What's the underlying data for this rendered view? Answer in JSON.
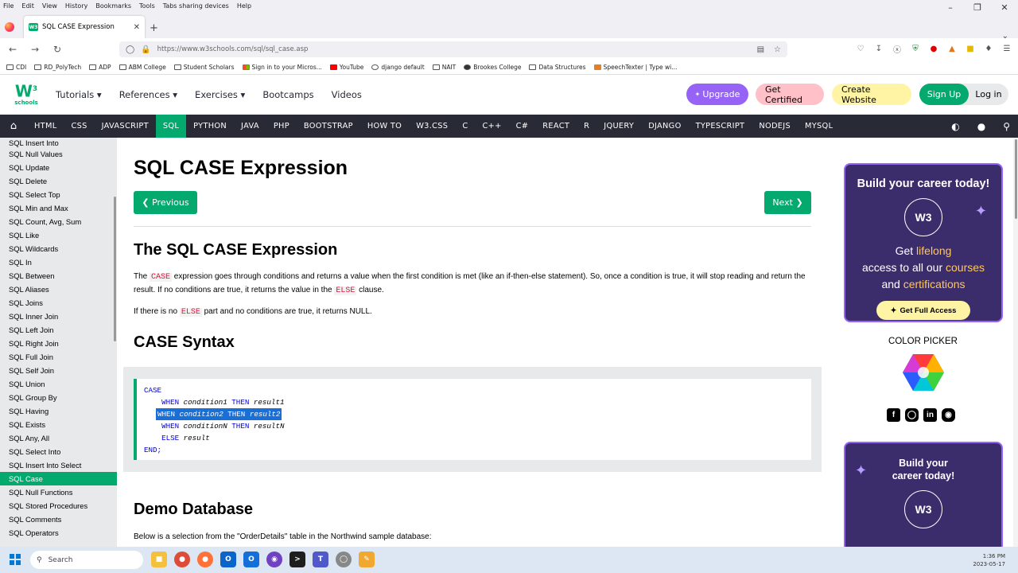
{
  "browser": {
    "menu": [
      "File",
      "Edit",
      "View",
      "History",
      "Bookmarks",
      "Tools",
      "Tabs sharing devices",
      "Help"
    ],
    "tab_title": "SQL CASE Expression",
    "url": "https://www.w3schools.com/sql/sql_case.asp",
    "bookmarks": [
      "CDI",
      "RD_PolyTech",
      "ADP",
      "ABM College",
      "Student Scholars",
      "Sign in to your Micros...",
      "YouTube",
      "django default",
      "NAIT",
      "Brookes College",
      "Data Structures",
      "SpeechTexter | Type wi..."
    ]
  },
  "header": {
    "logo_mark": "W",
    "logo_sup": "3",
    "logo_text": "schools",
    "nav": [
      "Tutorials ▾",
      "References ▾",
      "Exercises ▾",
      "Bootcamps",
      "Videos"
    ],
    "upgrade": "Upgrade",
    "certified": "Get Certified",
    "create_website": "Create Website",
    "signup": "Sign Up",
    "login": "Log in"
  },
  "topics": [
    "HTML",
    "CSS",
    "JAVASCRIPT",
    "SQL",
    "PYTHON",
    "JAVA",
    "PHP",
    "BOOTSTRAP",
    "HOW TO",
    "W3.CSS",
    "C",
    "C++",
    "C#",
    "REACT",
    "R",
    "JQUERY",
    "DJANGO",
    "TYPESCRIPT",
    "NODEJS",
    "MYSQL"
  ],
  "active_topic": "SQL",
  "sidebar": {
    "items": [
      "SQL Insert Into",
      "SQL Null Values",
      "SQL Update",
      "SQL Delete",
      "SQL Select Top",
      "SQL Min and Max",
      "SQL Count, Avg, Sum",
      "SQL Like",
      "SQL Wildcards",
      "SQL In",
      "SQL Between",
      "SQL Aliases",
      "SQL Joins",
      "SQL Inner Join",
      "SQL Left Join",
      "SQL Right Join",
      "SQL Full Join",
      "SQL Self Join",
      "SQL Union",
      "SQL Group By",
      "SQL Having",
      "SQL Exists",
      "SQL Any, All",
      "SQL Select Into",
      "SQL Insert Into Select",
      "SQL Case",
      "SQL Null Functions",
      "SQL Stored Procedures",
      "SQL Comments",
      "SQL Operators"
    ],
    "active": "SQL Case"
  },
  "main": {
    "title": "SQL CASE Expression",
    "prev": "❮ Previous",
    "next": "Next ❯",
    "h_case": "The SQL CASE Expression",
    "p1_a": "The ",
    "p1_kw": "CASE",
    "p1_b": " expression goes through conditions and returns a value when the first condition is met (like an if-then-else statement). So, once a condition is true, it will stop reading and return the result. If no conditions are true, it returns the value in the ",
    "p1_kw2": "ELSE",
    "p1_c": " clause.",
    "p2_a": "If there is no ",
    "p2_kw": "ELSE",
    "p2_b": " part and no conditions are true, it returns NULL.",
    "h_syntax": "CASE Syntax",
    "code": {
      "l1": "CASE",
      "when": "WHEN",
      "then": "THEN",
      "else": "ELSE",
      "c1": "condition1",
      "r1": "result1",
      "c2": "condition2",
      "r2": "result2",
      "cN": "conditionN",
      "rN": "resultN",
      "res": "result",
      "end": "END;"
    },
    "h_demo": "Demo Database",
    "p3": "Below is a selection from the \"OrderDetails\" table in the Northwind sample database:"
  },
  "right": {
    "ad1_title": "Build your career today!",
    "ad1_get": "Get ",
    "ad1_lifelong": "lifelong",
    "ad1_access": "access to all our ",
    "ad1_courses": "courses",
    "ad1_and": "and ",
    "ad1_certs": "certifications",
    "ad1_btn": "Get Full Access",
    "colorpicker": "COLOR PICKER",
    "ad2_title_1": "Build your",
    "ad2_title_2": "career today!"
  },
  "taskbar": {
    "search": "Search",
    "time": "1:36 PM",
    "date": "2023-05-17"
  },
  "colors": {
    "accent": "#04AA6D",
    "dark_nav": "#282A35",
    "sidebar_bg": "#E7E9EB",
    "upgrade": "#9763f6"
  }
}
